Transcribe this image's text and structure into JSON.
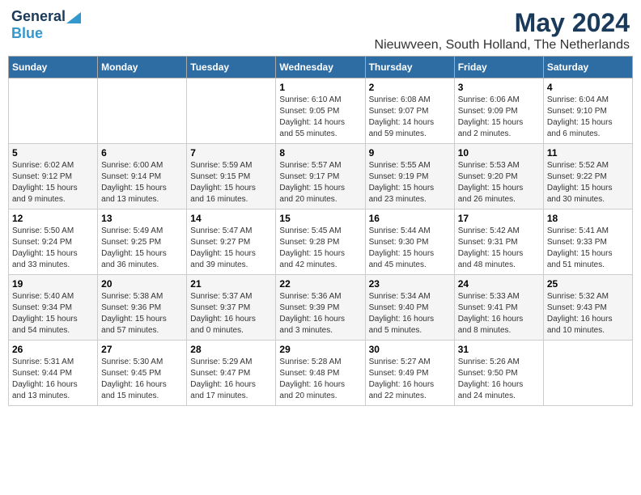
{
  "logo": {
    "general": "General",
    "blue": "Blue"
  },
  "title": "May 2024",
  "subtitle": "Nieuwveen, South Holland, The Netherlands",
  "weekdays": [
    "Sunday",
    "Monday",
    "Tuesday",
    "Wednesday",
    "Thursday",
    "Friday",
    "Saturday"
  ],
  "weeks": [
    [
      {
        "day": "",
        "info": ""
      },
      {
        "day": "",
        "info": ""
      },
      {
        "day": "",
        "info": ""
      },
      {
        "day": "1",
        "info": "Sunrise: 6:10 AM\nSunset: 9:05 PM\nDaylight: 14 hours\nand 55 minutes."
      },
      {
        "day": "2",
        "info": "Sunrise: 6:08 AM\nSunset: 9:07 PM\nDaylight: 14 hours\nand 59 minutes."
      },
      {
        "day": "3",
        "info": "Sunrise: 6:06 AM\nSunset: 9:09 PM\nDaylight: 15 hours\nand 2 minutes."
      },
      {
        "day": "4",
        "info": "Sunrise: 6:04 AM\nSunset: 9:10 PM\nDaylight: 15 hours\nand 6 minutes."
      }
    ],
    [
      {
        "day": "5",
        "info": "Sunrise: 6:02 AM\nSunset: 9:12 PM\nDaylight: 15 hours\nand 9 minutes."
      },
      {
        "day": "6",
        "info": "Sunrise: 6:00 AM\nSunset: 9:14 PM\nDaylight: 15 hours\nand 13 minutes."
      },
      {
        "day": "7",
        "info": "Sunrise: 5:59 AM\nSunset: 9:15 PM\nDaylight: 15 hours\nand 16 minutes."
      },
      {
        "day": "8",
        "info": "Sunrise: 5:57 AM\nSunset: 9:17 PM\nDaylight: 15 hours\nand 20 minutes."
      },
      {
        "day": "9",
        "info": "Sunrise: 5:55 AM\nSunset: 9:19 PM\nDaylight: 15 hours\nand 23 minutes."
      },
      {
        "day": "10",
        "info": "Sunrise: 5:53 AM\nSunset: 9:20 PM\nDaylight: 15 hours\nand 26 minutes."
      },
      {
        "day": "11",
        "info": "Sunrise: 5:52 AM\nSunset: 9:22 PM\nDaylight: 15 hours\nand 30 minutes."
      }
    ],
    [
      {
        "day": "12",
        "info": "Sunrise: 5:50 AM\nSunset: 9:24 PM\nDaylight: 15 hours\nand 33 minutes."
      },
      {
        "day": "13",
        "info": "Sunrise: 5:49 AM\nSunset: 9:25 PM\nDaylight: 15 hours\nand 36 minutes."
      },
      {
        "day": "14",
        "info": "Sunrise: 5:47 AM\nSunset: 9:27 PM\nDaylight: 15 hours\nand 39 minutes."
      },
      {
        "day": "15",
        "info": "Sunrise: 5:45 AM\nSunset: 9:28 PM\nDaylight: 15 hours\nand 42 minutes."
      },
      {
        "day": "16",
        "info": "Sunrise: 5:44 AM\nSunset: 9:30 PM\nDaylight: 15 hours\nand 45 minutes."
      },
      {
        "day": "17",
        "info": "Sunrise: 5:42 AM\nSunset: 9:31 PM\nDaylight: 15 hours\nand 48 minutes."
      },
      {
        "day": "18",
        "info": "Sunrise: 5:41 AM\nSunset: 9:33 PM\nDaylight: 15 hours\nand 51 minutes."
      }
    ],
    [
      {
        "day": "19",
        "info": "Sunrise: 5:40 AM\nSunset: 9:34 PM\nDaylight: 15 hours\nand 54 minutes."
      },
      {
        "day": "20",
        "info": "Sunrise: 5:38 AM\nSunset: 9:36 PM\nDaylight: 15 hours\nand 57 minutes."
      },
      {
        "day": "21",
        "info": "Sunrise: 5:37 AM\nSunset: 9:37 PM\nDaylight: 16 hours\nand 0 minutes."
      },
      {
        "day": "22",
        "info": "Sunrise: 5:36 AM\nSunset: 9:39 PM\nDaylight: 16 hours\nand 3 minutes."
      },
      {
        "day": "23",
        "info": "Sunrise: 5:34 AM\nSunset: 9:40 PM\nDaylight: 16 hours\nand 5 minutes."
      },
      {
        "day": "24",
        "info": "Sunrise: 5:33 AM\nSunset: 9:41 PM\nDaylight: 16 hours\nand 8 minutes."
      },
      {
        "day": "25",
        "info": "Sunrise: 5:32 AM\nSunset: 9:43 PM\nDaylight: 16 hours\nand 10 minutes."
      }
    ],
    [
      {
        "day": "26",
        "info": "Sunrise: 5:31 AM\nSunset: 9:44 PM\nDaylight: 16 hours\nand 13 minutes."
      },
      {
        "day": "27",
        "info": "Sunrise: 5:30 AM\nSunset: 9:45 PM\nDaylight: 16 hours\nand 15 minutes."
      },
      {
        "day": "28",
        "info": "Sunrise: 5:29 AM\nSunset: 9:47 PM\nDaylight: 16 hours\nand 17 minutes."
      },
      {
        "day": "29",
        "info": "Sunrise: 5:28 AM\nSunset: 9:48 PM\nDaylight: 16 hours\nand 20 minutes."
      },
      {
        "day": "30",
        "info": "Sunrise: 5:27 AM\nSunset: 9:49 PM\nDaylight: 16 hours\nand 22 minutes."
      },
      {
        "day": "31",
        "info": "Sunrise: 5:26 AM\nSunset: 9:50 PM\nDaylight: 16 hours\nand 24 minutes."
      },
      {
        "day": "",
        "info": ""
      }
    ]
  ]
}
